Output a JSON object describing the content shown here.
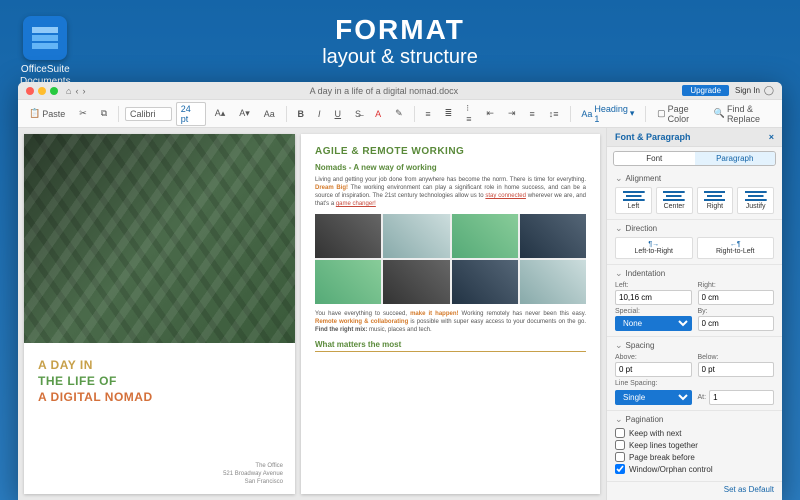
{
  "hero": {
    "title": "FORMAT",
    "subtitle": "layout & structure"
  },
  "brand": {
    "line1": "OfficeSuite",
    "line2": "Documents"
  },
  "window": {
    "title": "A day in a life of a digital nomad.docx",
    "upgrade": "Upgrade",
    "signin": "Sign In"
  },
  "toolbar": {
    "paste": "Paste",
    "font": "Calibri",
    "size": "24 pt",
    "style": "Heading 1",
    "pagecolor": "Page Color",
    "findreplace": "Find & Replace"
  },
  "doc": {
    "p1": {
      "l1": "A DAY IN",
      "l2": "THE LIFE OF",
      "l3": "A DIGITAL NOMAD",
      "foot1": "The Office",
      "foot2": "521 Broadway Avenue",
      "foot3": "San Francisco"
    },
    "p2": {
      "h1": "AGILE & REMOTE WORKING",
      "h2": "Nomads - A new way of working",
      "para1a": "Living and getting your job done from anywhere has become the norm. There is time for everything. ",
      "para1b": "Dream Big!",
      "para1c": " The working environment can play a significant role in home success, and can be a source of inspiration. The 21st century technologies allow us to ",
      "para1d": "stay connected",
      "para1e": " wherever we are, and that's a ",
      "para1f": "game changer!",
      "para2a": "You have everything to succeed, ",
      "para2b": "make it happen!",
      "para2c": " Working remotely has never been this easy. ",
      "para2d": "Remote working & collaborating",
      "para2e": " is possible with super easy access to your documents on the go. ",
      "para2f": "Find the right mix:",
      "para2g": " music, places and tech.",
      "h3": "What matters the most"
    }
  },
  "panel": {
    "title": "Font & Paragraph",
    "tabs": {
      "font": "Font",
      "paragraph": "Paragraph"
    },
    "alignment": {
      "h": "Alignment",
      "left": "Left",
      "center": "Center",
      "right": "Right",
      "justify": "Justify"
    },
    "direction": {
      "h": "Direction",
      "ltr": "Left-to-Right",
      "rtl": "Right-to-Left"
    },
    "indent": {
      "h": "Indentation",
      "left": "Left:",
      "leftv": "10,16 cm",
      "right": "Right:",
      "rightv": "0 cm",
      "special": "Special:",
      "specialv": "None",
      "by": "By:",
      "byv": "0 cm"
    },
    "spacing": {
      "h": "Spacing",
      "above": "Above:",
      "abovev": "0 pt",
      "below": "Below:",
      "belowv": "0 pt",
      "ls": "Line Spacing:",
      "lsv": "Single",
      "at": "At:",
      "atv": "1"
    },
    "pagination": {
      "h": "Pagination",
      "o1": "Keep with next",
      "o2": "Keep lines together",
      "o3": "Page break before",
      "o4": "Window/Orphan control"
    },
    "setdefault": "Set as Default"
  }
}
